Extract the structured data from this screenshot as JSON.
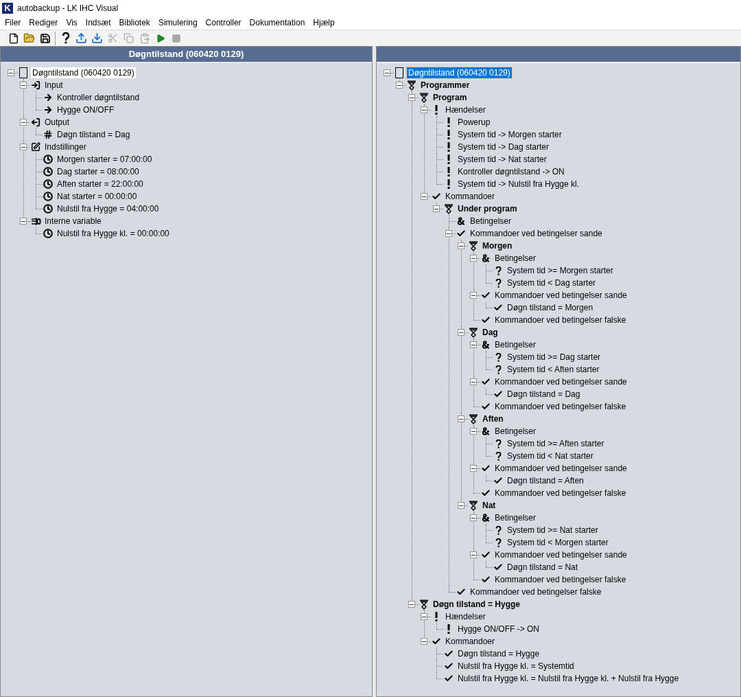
{
  "window": {
    "icon_letter": "K",
    "title": "autobackup - LK IHC Visual"
  },
  "menu": [
    "Filer",
    "Rediger",
    "Vis",
    "Indsæt",
    "Bibliotek",
    "Simulering",
    "Controller",
    "Dokumentation",
    "Hjælp"
  ],
  "toolbar": [
    {
      "kind": "new",
      "disabled": false
    },
    {
      "kind": "open",
      "disabled": false
    },
    {
      "kind": "save",
      "disabled": false
    },
    {
      "kind": "separator"
    },
    {
      "kind": "help",
      "disabled": false
    },
    {
      "kind": "upload",
      "disabled": false
    },
    {
      "kind": "download",
      "disabled": false
    },
    {
      "kind": "cut",
      "disabled": true
    },
    {
      "kind": "copy",
      "disabled": true
    },
    {
      "kind": "paste",
      "disabled": true
    },
    {
      "kind": "run",
      "disabled": false
    },
    {
      "kind": "stop",
      "disabled": true
    }
  ],
  "left_pane": {
    "title": "Døgntilstand (060420 0129)",
    "focused": false,
    "tree": [
      {
        "label": "Døgntilstand (060420 0129)",
        "kind": "document",
        "selected": true,
        "expanded": true,
        "children": [
          {
            "label": "Input",
            "kind": "input",
            "selected": false,
            "expanded": true,
            "children": [
              {
                "label": "Kontroller døgntilstand",
                "kind": "arrow",
                "selected": false
              },
              {
                "label": "Hygge ON/OFF",
                "kind": "arrow",
                "selected": false
              }
            ]
          },
          {
            "label": "Output",
            "kind": "output",
            "selected": false,
            "expanded": true,
            "children": [
              {
                "label": "Døgn tilstand = Dag",
                "kind": "hash",
                "selected": false
              }
            ]
          },
          {
            "label": "Indstillinger",
            "kind": "settings",
            "selected": false,
            "expanded": true,
            "children": [
              {
                "label": "Morgen starter = 07:00:00",
                "kind": "clock",
                "selected": false
              },
              {
                "label": "Dag starter = 08:00:00",
                "kind": "clock",
                "selected": false
              },
              {
                "label": "Aften starter = 22:00:00",
                "kind": "clock",
                "selected": false
              },
              {
                "label": "Nat starter = 00:00:00",
                "kind": "clock",
                "selected": false
              },
              {
                "label": "Nulstil fra Hygge = 04:00:00",
                "kind": "clock",
                "selected": false
              }
            ]
          },
          {
            "label": "Interne variable",
            "kind": "variable",
            "selected": false,
            "expanded": true,
            "children": [
              {
                "label": "Nulstil fra Hygge kl. = 00:00:00",
                "kind": "clock",
                "selected": false
              }
            ]
          }
        ]
      }
    ]
  },
  "right_pane": {
    "focused": true,
    "tree": [
      {
        "label": "Døgntilstand (060420 0129)",
        "kind": "document",
        "selected": true,
        "expanded": true,
        "children": [
          {
            "label": "Programmer",
            "kind": "program",
            "selected": false,
            "expanded": true,
            "children": [
              {
                "label": "Program",
                "kind": "program",
                "selected": false,
                "expanded": true,
                "children": [
                  {
                    "label": "Hændelser",
                    "kind": "event",
                    "selected": false,
                    "expanded": true,
                    "children": [
                      {
                        "label": "Powerup",
                        "kind": "event",
                        "selected": false
                      },
                      {
                        "label": "System tid -> Morgen starter",
                        "kind": "event",
                        "selected": false
                      },
                      {
                        "label": "System tid -> Dag starter",
                        "kind": "event",
                        "selected": false
                      },
                      {
                        "label": "System tid -> Nat starter",
                        "kind": "event",
                        "selected": false
                      },
                      {
                        "label": "Kontroller døgntilstand -> ON",
                        "kind": "event",
                        "selected": false
                      },
                      {
                        "label": "System tid -> Nulstil fra Hygge kl.",
                        "kind": "event",
                        "selected": false
                      }
                    ]
                  },
                  {
                    "label": "Kommandoer",
                    "kind": "command",
                    "selected": false,
                    "expanded": true,
                    "children": [
                      {
                        "label": "Under program",
                        "kind": "program",
                        "selected": false,
                        "expanded": true,
                        "children": [
                          {
                            "label": "Betingelser",
                            "kind": "condition",
                            "selected": false
                          },
                          {
                            "label": "Kommandoer ved betingelser sande",
                            "kind": "command",
                            "selected": false,
                            "expanded": true,
                            "children": [
                              {
                                "label": "Morgen",
                                "kind": "program",
                                "selected": false,
                                "expanded": true,
                                "children": [
                                  {
                                    "label": "Betingelser",
                                    "kind": "condition",
                                    "selected": false,
                                    "expanded": true,
                                    "children": [
                                      {
                                        "label": "System tid >= Morgen starter",
                                        "kind": "question",
                                        "selected": false
                                      },
                                      {
                                        "label": "System tid < Dag starter",
                                        "kind": "question",
                                        "selected": false
                                      }
                                    ]
                                  },
                                  {
                                    "label": "Kommandoer ved betingelser sande",
                                    "kind": "command",
                                    "selected": false,
                                    "expanded": true,
                                    "children": [
                                      {
                                        "label": "Døgn tilstand = Morgen",
                                        "kind": "command",
                                        "selected": false
                                      }
                                    ]
                                  },
                                  {
                                    "label": "Kommandoer ved betingelser falske",
                                    "kind": "command",
                                    "selected": false
                                  }
                                ]
                              },
                              {
                                "label": "Dag",
                                "kind": "program",
                                "selected": false,
                                "expanded": true,
                                "children": [
                                  {
                                    "label": "Betingelser",
                                    "kind": "condition",
                                    "selected": false,
                                    "expanded": true,
                                    "children": [
                                      {
                                        "label": "System tid >= Dag starter",
                                        "kind": "question",
                                        "selected": false
                                      },
                                      {
                                        "label": "System tid < Aften starter",
                                        "kind": "question",
                                        "selected": false
                                      }
                                    ]
                                  },
                                  {
                                    "label": "Kommandoer ved betingelser sande",
                                    "kind": "command",
                                    "selected": false,
                                    "expanded": true,
                                    "children": [
                                      {
                                        "label": "Døgn tilstand = Dag",
                                        "kind": "command",
                                        "selected": false
                                      }
                                    ]
                                  },
                                  {
                                    "label": "Kommandoer ved betingelser falske",
                                    "kind": "command",
                                    "selected": false
                                  }
                                ]
                              },
                              {
                                "label": "Aften",
                                "kind": "program",
                                "selected": false,
                                "expanded": true,
                                "children": [
                                  {
                                    "label": "Betingelser",
                                    "kind": "condition",
                                    "selected": false,
                                    "expanded": true,
                                    "children": [
                                      {
                                        "label": "System tid >= Aften starter",
                                        "kind": "question",
                                        "selected": false
                                      },
                                      {
                                        "label": "System tid < Nat starter",
                                        "kind": "question",
                                        "selected": false
                                      }
                                    ]
                                  },
                                  {
                                    "label": "Kommandoer ved betingelser sande",
                                    "kind": "command",
                                    "selected": false,
                                    "expanded": true,
                                    "children": [
                                      {
                                        "label": "Døgn tilstand = Aften",
                                        "kind": "command",
                                        "selected": false
                                      }
                                    ]
                                  },
                                  {
                                    "label": "Kommandoer ved betingelser falske",
                                    "kind": "command",
                                    "selected": false
                                  }
                                ]
                              },
                              {
                                "label": "Nat",
                                "kind": "program",
                                "selected": false,
                                "expanded": true,
                                "children": [
                                  {
                                    "label": "Betingelser",
                                    "kind": "condition",
                                    "selected": false,
                                    "expanded": true,
                                    "children": [
                                      {
                                        "label": "System tid >= Nat starter",
                                        "kind": "question",
                                        "selected": false
                                      },
                                      {
                                        "label": "System tid < Morgen starter",
                                        "kind": "question",
                                        "selected": false
                                      }
                                    ]
                                  },
                                  {
                                    "label": "Kommandoer ved betingelser sande",
                                    "kind": "command",
                                    "selected": false,
                                    "expanded": true,
                                    "children": [
                                      {
                                        "label": "Døgn tilstand = Nat",
                                        "kind": "command",
                                        "selected": false
                                      }
                                    ]
                                  },
                                  {
                                    "label": "Kommandoer ved betingelser falske",
                                    "kind": "command",
                                    "selected": false
                                  }
                                ]
                              }
                            ]
                          },
                          {
                            "label": "Kommandoer ved betingelser falske",
                            "kind": "command",
                            "selected": false
                          }
                        ]
                      }
                    ]
                  }
                ]
              },
              {
                "label": "Døgn tilstand = Hygge",
                "kind": "program",
                "selected": false,
                "expanded": true,
                "children": [
                  {
                    "label": "Hændelser",
                    "kind": "event",
                    "selected": false,
                    "expanded": true,
                    "children": [
                      {
                        "label": "Hygge ON/OFF -> ON",
                        "kind": "event",
                        "selected": false
                      }
                    ]
                  },
                  {
                    "label": "Kommandoer",
                    "kind": "command",
                    "selected": false,
                    "expanded": true,
                    "children": [
                      {
                        "label": "Døgn tilstand = Hygge",
                        "kind": "command",
                        "selected": false
                      },
                      {
                        "label": "Nulstil fra Hygge kl. = Systemtid",
                        "kind": "command",
                        "selected": false
                      },
                      {
                        "label": "Nulstil fra Hygge kl. = Nulstil fra Hygge kl. + Nulstil fra Hygge",
                        "kind": "command",
                        "selected": false
                      }
                    ]
                  }
                ]
              }
            ]
          }
        ]
      }
    ]
  }
}
